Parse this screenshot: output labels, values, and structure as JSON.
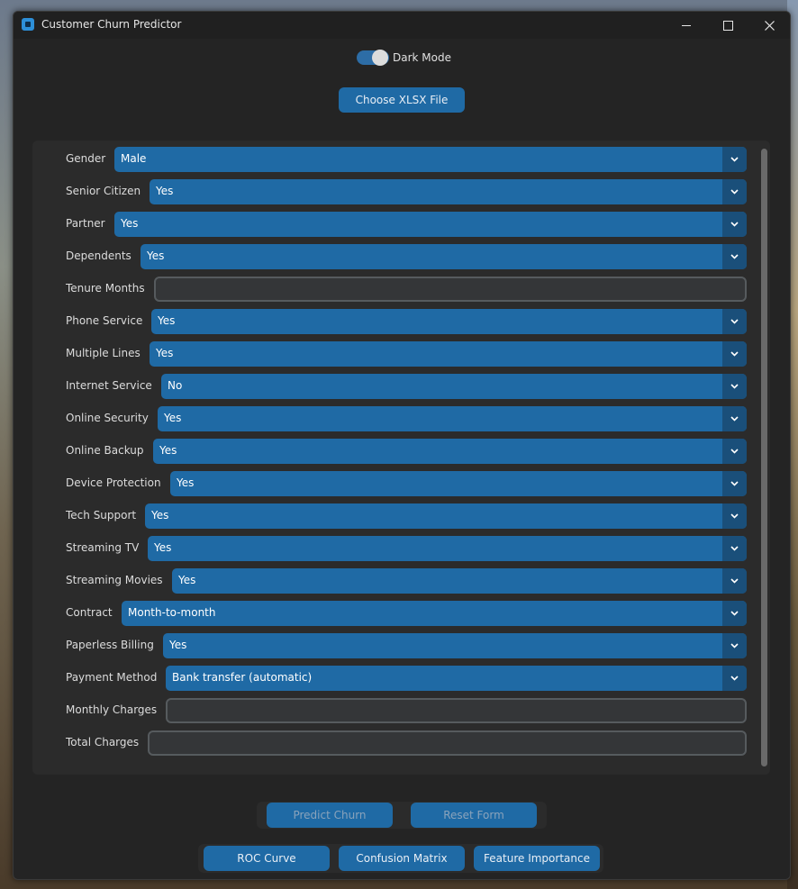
{
  "window": {
    "title": "Customer Churn Predictor",
    "controls": [
      "minimize",
      "maximize",
      "close"
    ]
  },
  "header": {
    "dark_mode_label": "Dark Mode",
    "dark_mode_on": true,
    "choose_file_label": "Choose XLSX File"
  },
  "form": {
    "fields": [
      {
        "label": "Gender",
        "type": "dropdown",
        "value": "Male"
      },
      {
        "label": "Senior Citizen",
        "type": "dropdown",
        "value": "Yes"
      },
      {
        "label": "Partner",
        "type": "dropdown",
        "value": "Yes"
      },
      {
        "label": "Dependents",
        "type": "dropdown",
        "value": "Yes"
      },
      {
        "label": "Tenure Months",
        "type": "entry",
        "value": ""
      },
      {
        "label": "Phone Service",
        "type": "dropdown",
        "value": "Yes"
      },
      {
        "label": "Multiple Lines",
        "type": "dropdown",
        "value": "Yes"
      },
      {
        "label": "Internet Service",
        "type": "dropdown",
        "value": "No"
      },
      {
        "label": "Online Security",
        "type": "dropdown",
        "value": "Yes"
      },
      {
        "label": "Online Backup",
        "type": "dropdown",
        "value": "Yes"
      },
      {
        "label": "Device Protection",
        "type": "dropdown",
        "value": "Yes"
      },
      {
        "label": "Tech Support",
        "type": "dropdown",
        "value": "Yes"
      },
      {
        "label": "Streaming TV",
        "type": "dropdown",
        "value": "Yes"
      },
      {
        "label": "Streaming Movies",
        "type": "dropdown",
        "value": "Yes"
      },
      {
        "label": "Contract",
        "type": "dropdown",
        "value": "Month-to-month"
      },
      {
        "label": "Paperless Billing",
        "type": "dropdown",
        "value": "Yes"
      },
      {
        "label": "Payment Method",
        "type": "dropdown",
        "value": "Bank transfer (automatic)"
      },
      {
        "label": "Monthly Charges",
        "type": "entry",
        "value": ""
      },
      {
        "label": "Total Charges",
        "type": "entry",
        "value": ""
      }
    ]
  },
  "actions": {
    "predict_label": "Predict Churn",
    "reset_label": "Reset Form",
    "roc_label": "ROC Curve",
    "confusion_label": "Confusion Matrix",
    "feature_label": "Feature Importance"
  },
  "colors": {
    "accent": "#1f6aa5",
    "background": "#242424",
    "panel": "#2b2b2b"
  }
}
